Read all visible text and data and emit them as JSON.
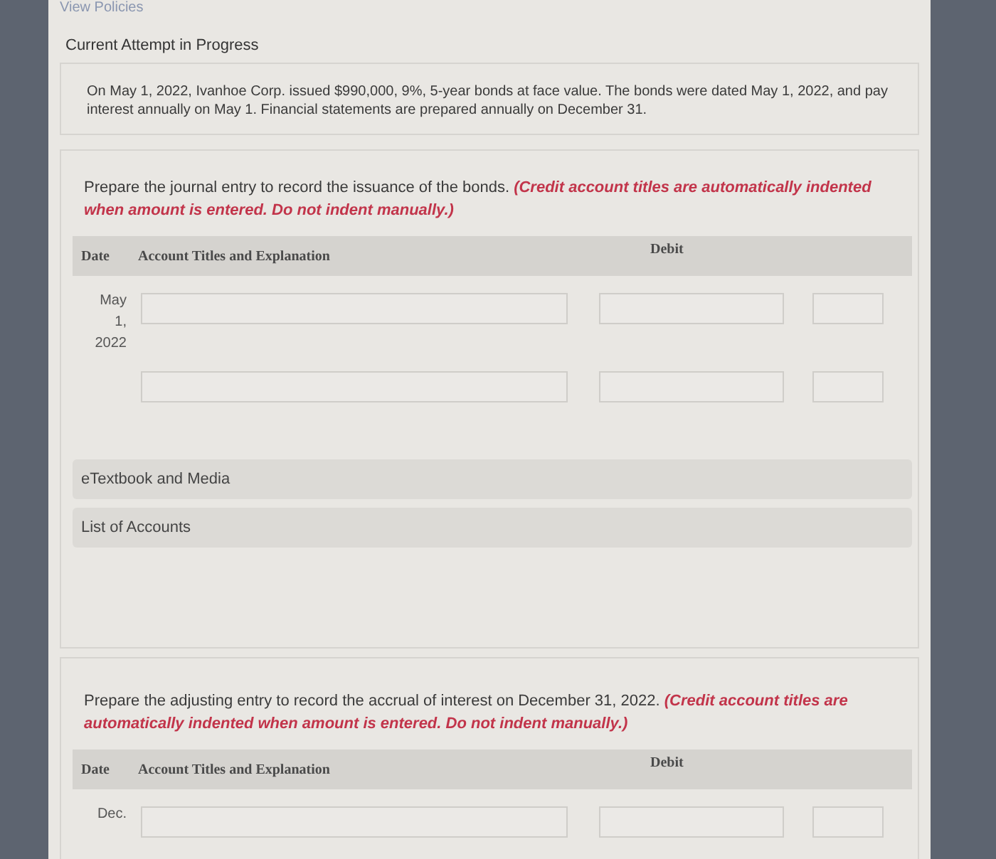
{
  "header_link": "View Policies",
  "section_title": "Current Attempt in Progress",
  "problem_text": "On May 1, 2022, Ivanhoe Corp. issued $990,000, 9%, 5-year bonds at face value. The bonds were dated May 1, 2022, and pay interest annually on May 1. Financial statements are prepared annually on December 31.",
  "parts": [
    {
      "instruction": "Prepare the journal entry to record the issuance of the bonds. **(Credit account titles are automatically indented when amount is entered. Do not indent manually.)**",
      "columns": [
        "Date",
        "Account Titles and Explanation",
        "Debit"
      ],
      "rows": [
        {
          "date_lines": [
            "May",
            "1,",
            "2022"
          ]
        },
        {}
      ],
      "links": [
        "eTextbook and Media",
        "List of Accounts"
      ]
    },
    {
      "instruction": "Prepare the adjusting entry to record the accrual of interest on December 31, 2022. **(Credit account titles are automatically indented when amount is entered. Do not indent manually.)**",
      "columns": [
        "Date",
        "Account Titles and Explanation",
        "Debit"
      ],
      "rows": [
        {
          "date_lines": [
            "Dec."
          ]
        }
      ]
    }
  ]
}
